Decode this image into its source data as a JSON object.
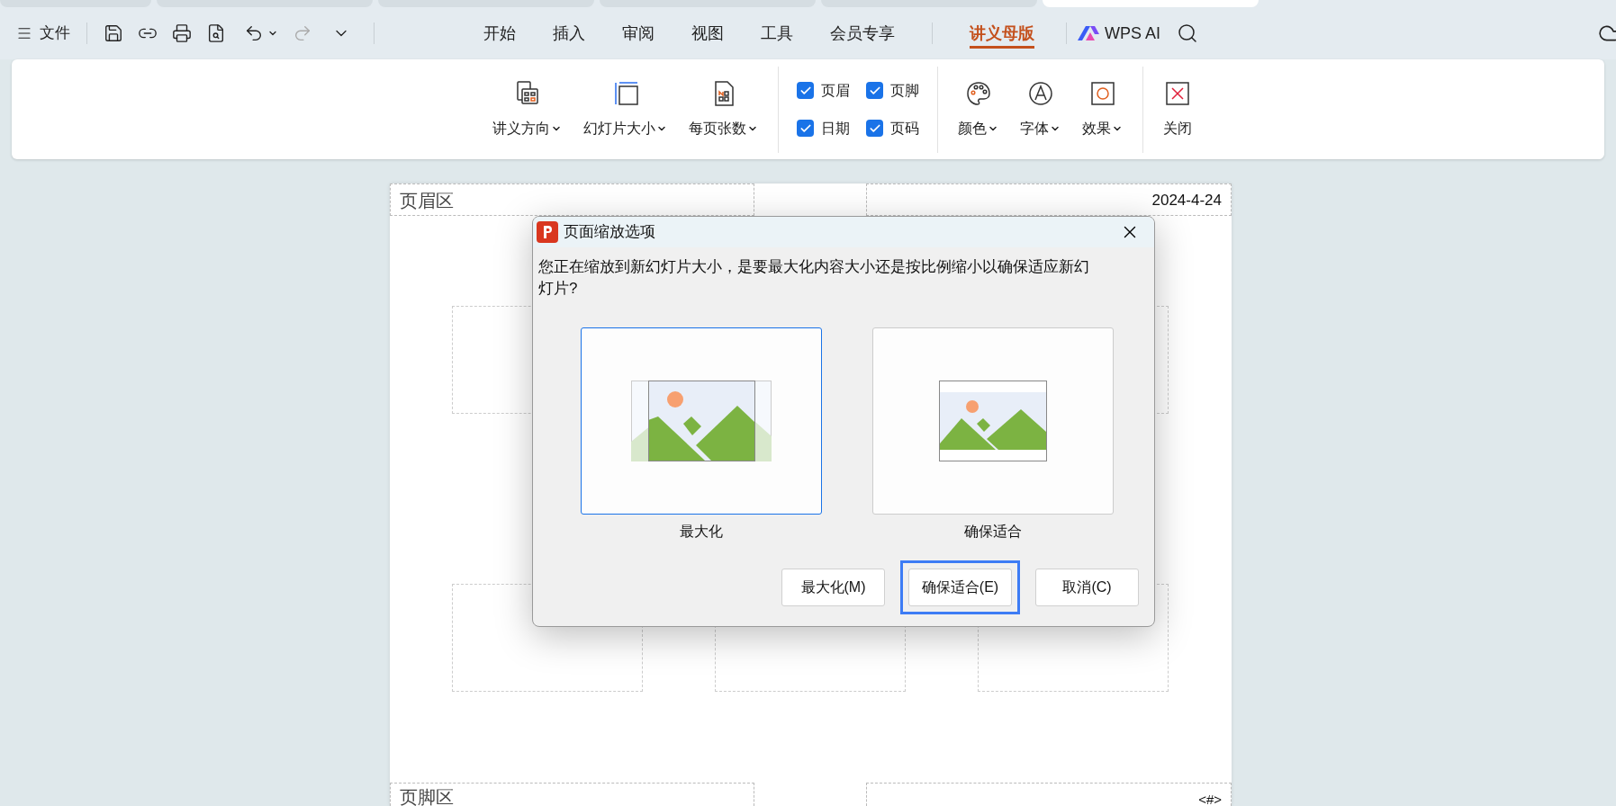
{
  "document_tabs": [
    {
      "selected": false
    },
    {
      "selected": false
    },
    {
      "selected": false
    },
    {
      "selected": false
    },
    {
      "selected": false
    },
    {
      "selected": true
    }
  ],
  "menu_bar": {
    "file_label": "文件",
    "tabs": [
      {
        "label": "开始",
        "selected": false
      },
      {
        "label": "插入",
        "selected": false
      },
      {
        "label": "审阅",
        "selected": false
      },
      {
        "label": "视图",
        "selected": false
      },
      {
        "label": "工具",
        "selected": false
      },
      {
        "label": "会员专享",
        "selected": false
      },
      {
        "label": "讲义母版",
        "selected": true
      }
    ],
    "ai_label": "WPS AI"
  },
  "ribbon": {
    "layout_tools": [
      {
        "label": "讲义方向",
        "dropdown": true
      },
      {
        "label": "幻灯片大小",
        "dropdown": true
      },
      {
        "label": "每页张数",
        "dropdown": true
      }
    ],
    "checkboxes": [
      {
        "label": "页眉",
        "checked": true
      },
      {
        "label": "页脚",
        "checked": true
      },
      {
        "label": "日期",
        "checked": true
      },
      {
        "label": "页码",
        "checked": true
      }
    ],
    "style_tools": [
      {
        "label": "颜色",
        "dropdown": true
      },
      {
        "label": "字体",
        "dropdown": true
      },
      {
        "label": "效果",
        "dropdown": true
      }
    ],
    "close_label": "关闭"
  },
  "page": {
    "header_left": "页眉区",
    "header_right": "2024-4-24",
    "footer_left": "页脚区",
    "footer_right": "<#>"
  },
  "dialog": {
    "title": "页面缩放选项",
    "message": "您正在缩放到新幻灯片大小，是要最大化内容大小还是按比例缩小以确保适应新幻灯片?",
    "options": [
      {
        "kind": "maximize",
        "label": "最大化",
        "selected": true
      },
      {
        "kind": "fit",
        "label": "确保适合",
        "selected": false
      }
    ],
    "buttons": [
      {
        "label": "最大化(M)",
        "focused": false
      },
      {
        "label": "确保适合(E)",
        "focused": true
      },
      {
        "label": "取消(C)",
        "focused": false
      }
    ]
  }
}
